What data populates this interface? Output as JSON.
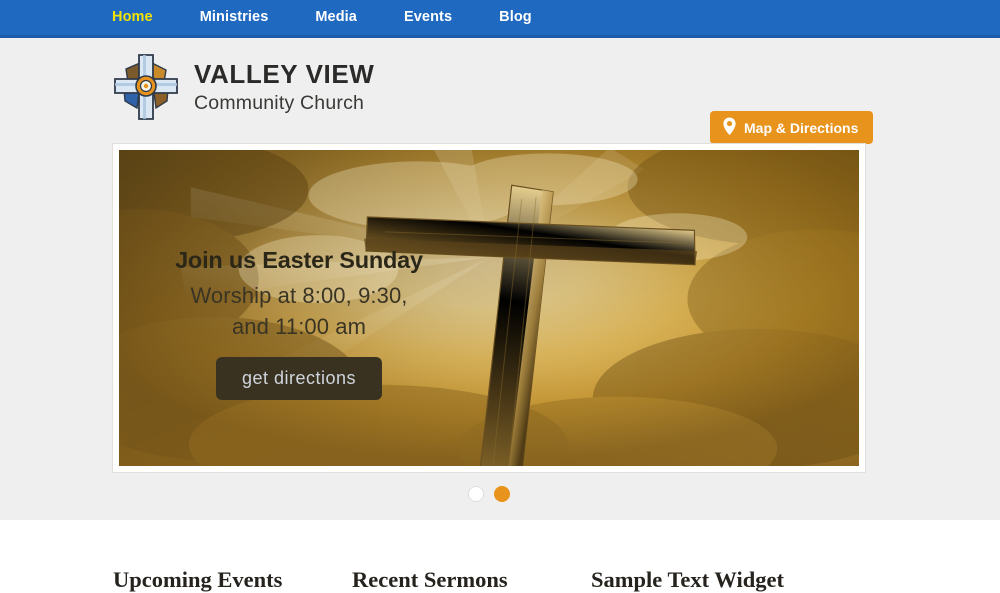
{
  "nav": {
    "items": [
      {
        "label": "Home",
        "active": true
      },
      {
        "label": "Ministries",
        "active": false
      },
      {
        "label": "Media",
        "active": false
      },
      {
        "label": "Events",
        "active": false
      },
      {
        "label": "Blog",
        "active": false
      }
    ],
    "background_color": "#2069c0",
    "active_color": "#f2e205",
    "link_color": "#ffffff"
  },
  "header": {
    "background_color": "#efefef",
    "logo_icon": "stained-glass-cross-icon",
    "brand_title": "VALLEY VIEW",
    "brand_subtitle": "Community Church",
    "map_button": {
      "label": "Map & Directions",
      "icon": "map-pin-icon",
      "background_color": "#e8931c",
      "text_color": "#ffffff"
    }
  },
  "slider": {
    "image_alt": "wooden-cross-golden-sky-photo",
    "caption_heading": "Join us Easter Sunday",
    "caption_line_1": "Worship at 8:00, 9:30,",
    "caption_line_2": "and 11:00 am",
    "cta_label": "get directions",
    "cta_background_color": "#3a3220",
    "cta_text_color": "#cfd5dd",
    "dots": [
      {
        "label": "1",
        "active": false
      },
      {
        "label": "2",
        "active": true
      }
    ],
    "dot_active_color": "#e8931c",
    "dot_inactive_color": "#ffffff"
  },
  "widgets": {
    "column_1_title": "Upcoming Events",
    "column_2_title": "Recent Sermons",
    "column_3_title": "Sample Text Widget"
  }
}
